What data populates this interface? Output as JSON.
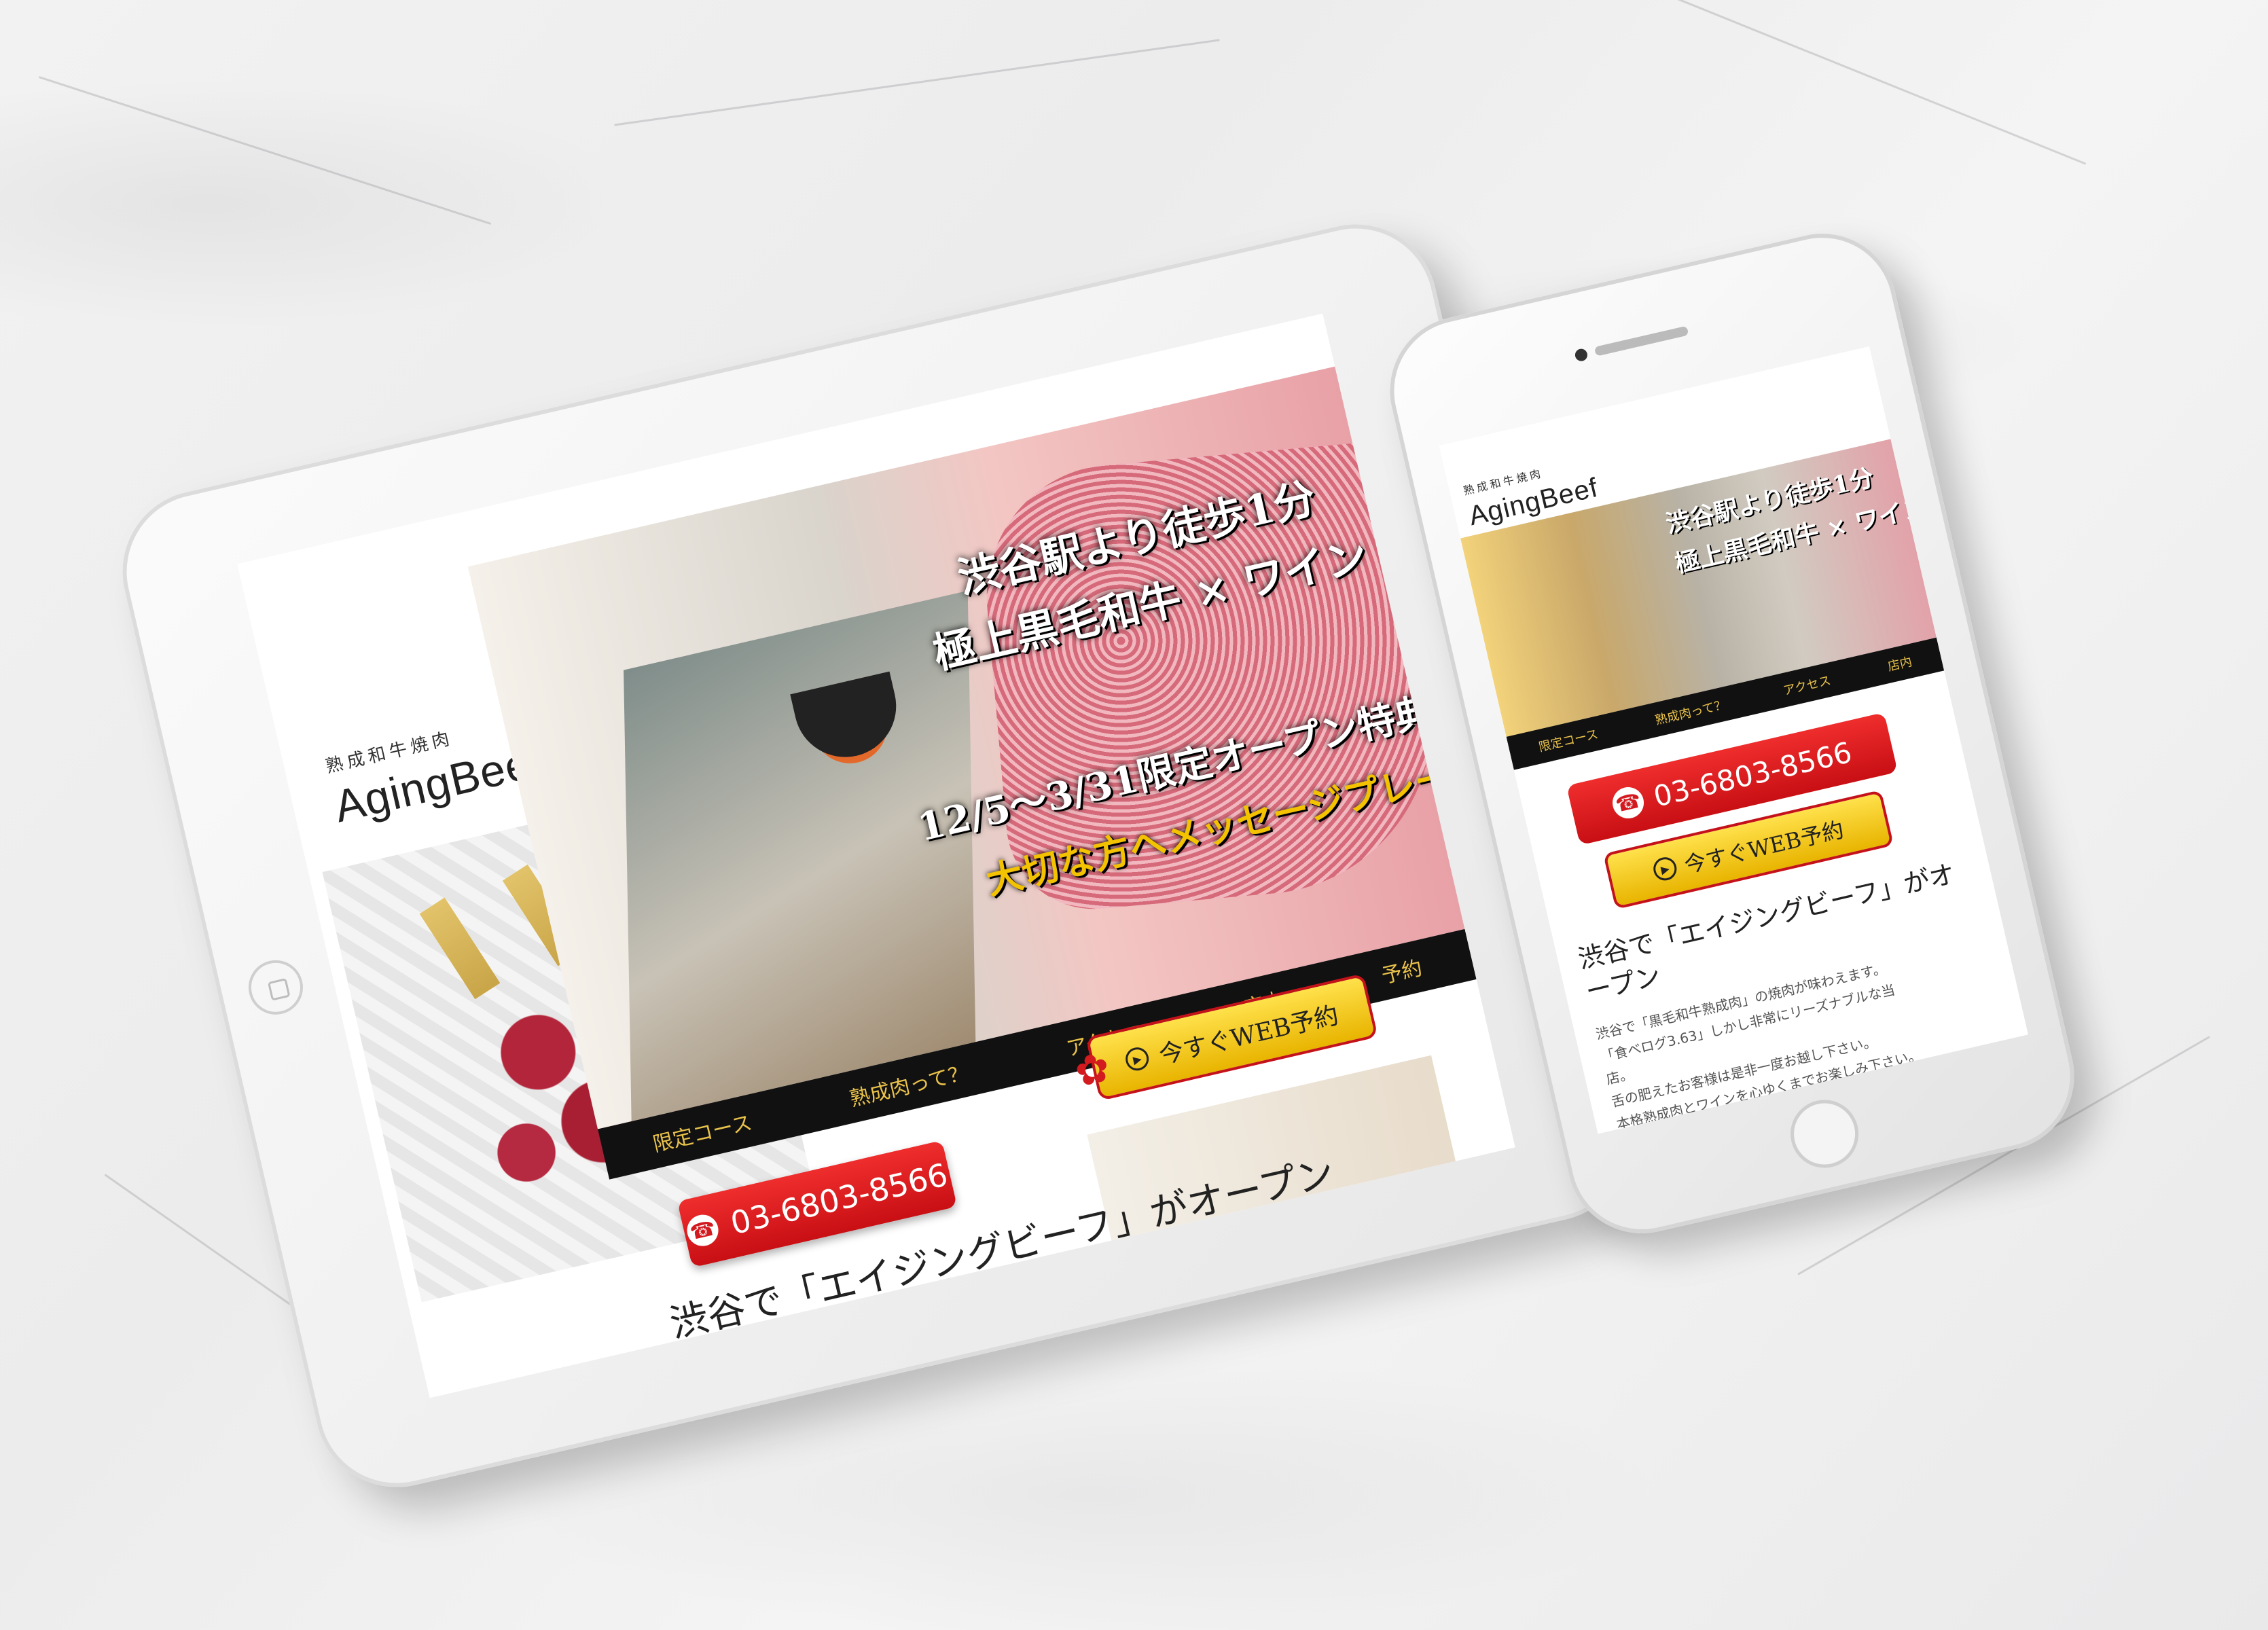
{
  "brand": {
    "subtitle": "熟成和牛焼肉",
    "name": "AgingBeef"
  },
  "hero": {
    "line1": "渋谷駅より徒歩1分",
    "line2": "極上黒毛和牛 × ワイン",
    "line3": "12/5〜3/31限定オープン特典",
    "line4": "大切な方へメッセージプレート"
  },
  "nav": {
    "items": [
      "限定コース",
      "熟成肉って？",
      "アクセス",
      "店内",
      "予約"
    ]
  },
  "cta": {
    "phone": "03-6803-8566",
    "web": "今すぐWEB予約"
  },
  "intro": {
    "title": "渋谷で「エイジングビーフ」がオープン",
    "p1": "渋谷で「黒毛和牛熟成肉」の焼肉が味わえます。",
    "p2": "「食べログ3.63」しかし非常にリーズナブルな当店。"
  },
  "phone_intro": {
    "title": "渋谷で「エイジングビーフ」がオープン",
    "lines": [
      "渋谷で「黒毛和牛熟成肉」の焼肉が味わえます。",
      "「食べログ3.63」しかし非常にリーズナブルな当",
      "店。",
      "舌の肥えたお客様は是非一度お越し下さい。",
      "本格熟成肉とワインを心ゆくまでお楽しみ下さい。"
    ]
  },
  "colors": {
    "accent_red": "#d21a1f",
    "gold": "#e9c24b",
    "nav_bg": "#111111"
  }
}
